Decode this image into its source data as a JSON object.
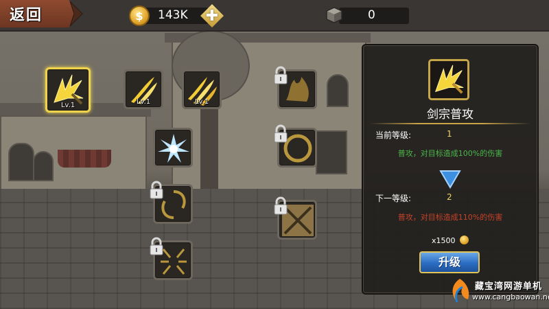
{
  "topbar": {
    "back_label": "返回",
    "gold_amount": "143K",
    "coin_symbol": "$",
    "plus_symbol": "✚",
    "gem_amount": "0"
  },
  "skills": [
    {
      "id": "slash",
      "level": "Lv.1",
      "locked": false,
      "selected": true
    },
    {
      "id": "twin-slash",
      "level": "Lv.1",
      "locked": false,
      "selected": false
    },
    {
      "id": "triple-slash",
      "level": "Lv.1",
      "locked": false,
      "selected": false
    },
    {
      "id": "ice-burst",
      "level": "",
      "locked": false,
      "selected": false
    },
    {
      "id": "locked-1",
      "level": "",
      "locked": true
    },
    {
      "id": "locked-2",
      "level": "",
      "locked": true
    },
    {
      "id": "locked-3",
      "level": "",
      "locked": true
    },
    {
      "id": "locked-4",
      "level": "",
      "locked": true
    },
    {
      "id": "locked-5",
      "level": "",
      "locked": true
    }
  ],
  "panel": {
    "skill_name": "剑宗普攻",
    "current_level_label": "当前等级:",
    "current_level": "1",
    "current_desc": "普攻，对目标造成100%的伤害",
    "next_level_label": "下一等级:",
    "next_level": "2",
    "next_desc": "普攻，对目标造成110%的伤害",
    "cost": "x1500",
    "upgrade_label": "升级"
  },
  "watermark": {
    "name": "藏宝湾网游单机",
    "url": "www.cangbaowan.net"
  },
  "colors": {
    "gold": "#f0d34c",
    "green_text": "#4bb74a",
    "red_text": "#c54228",
    "button_blue": "#2b6cc2"
  }
}
